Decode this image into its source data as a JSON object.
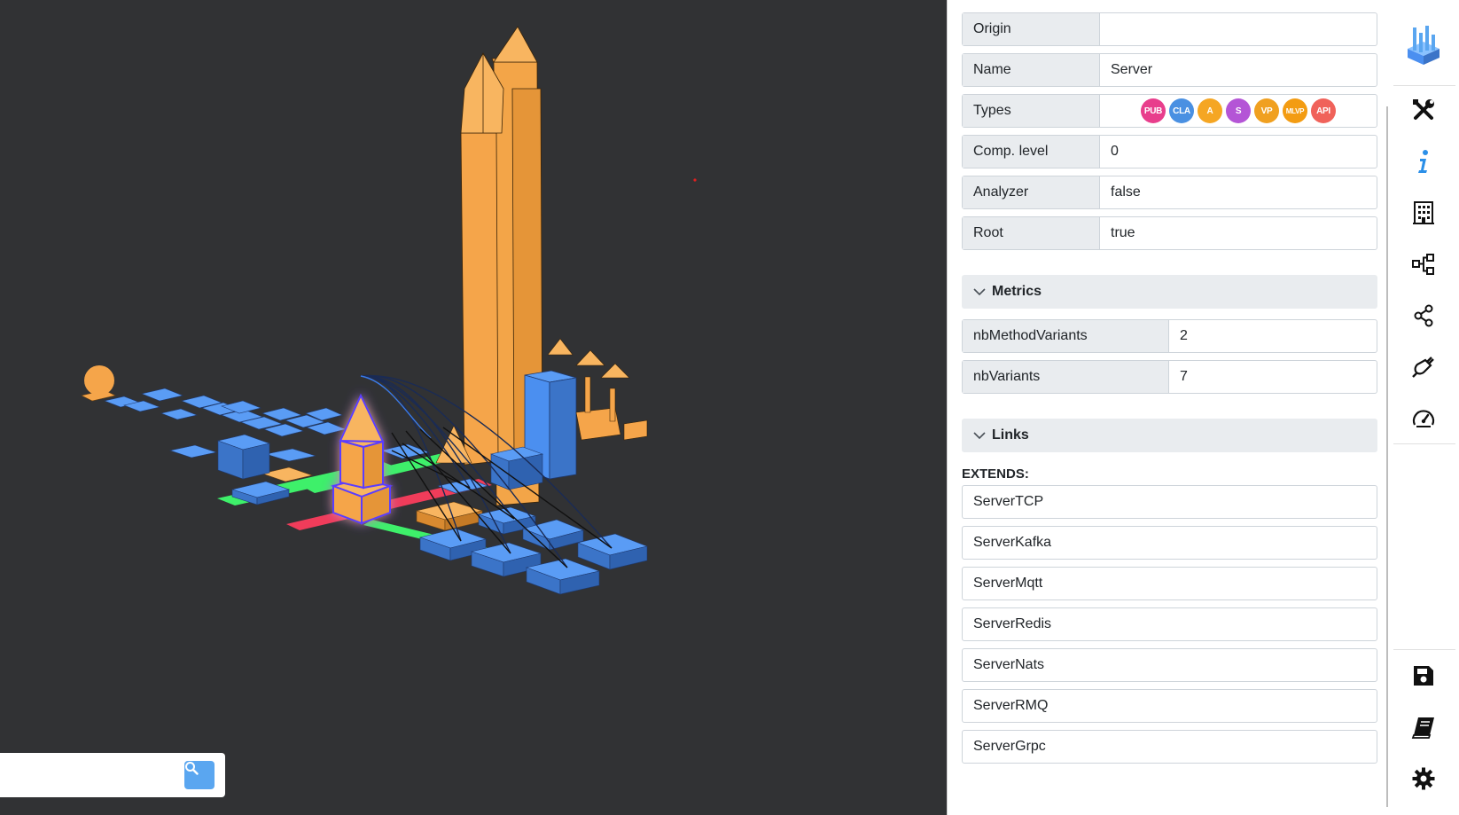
{
  "properties": [
    {
      "key": "Origin",
      "value": ""
    },
    {
      "key": "Name",
      "value": "Server"
    },
    {
      "key": "Types",
      "value": ""
    },
    {
      "key": "Comp. level",
      "value": "0"
    },
    {
      "key": "Analyzer",
      "value": "false"
    },
    {
      "key": "Root",
      "value": "true"
    }
  ],
  "types": [
    {
      "label": "PUB",
      "color": "#e83e8c"
    },
    {
      "label": "CLA",
      "color": "#4a90e2"
    },
    {
      "label": "A",
      "color": "#f5a623"
    },
    {
      "label": "S",
      "color": "#b455d6"
    },
    {
      "label": "VP",
      "color": "#f0a020"
    },
    {
      "label": "MLVP",
      "color": "#f39c12"
    },
    {
      "label": "API",
      "color": "#f0625a"
    }
  ],
  "metrics": {
    "title": "Metrics",
    "items": [
      {
        "key": "nbMethodVariants",
        "value": "2"
      },
      {
        "key": "nbVariants",
        "value": "7"
      }
    ]
  },
  "links": {
    "title": "Links",
    "extends_label": "EXTENDS:",
    "items": [
      "ServerTCP",
      "ServerKafka",
      "ServerMqtt",
      "ServerRedis",
      "ServerNats",
      "ServerRMQ",
      "ServerGrpc"
    ]
  },
  "search": {
    "placeholder": ""
  },
  "toolbar": {
    "top": [
      "logo-icon",
      "tools-icon",
      "info-icon",
      "building-icon",
      "hierarchy-icon",
      "share-icon",
      "plug-icon",
      "gauge-icon"
    ],
    "bottom": [
      "save-icon",
      "book-icon",
      "gear-icon"
    ]
  },
  "colors": {
    "viewport_bg": "#313234",
    "building_orange": "#f5a54a",
    "building_blue": "#4b8ff0",
    "road_green": "#3ef06a",
    "road_red": "#f03c5a",
    "accent": "#5aa6f0"
  }
}
